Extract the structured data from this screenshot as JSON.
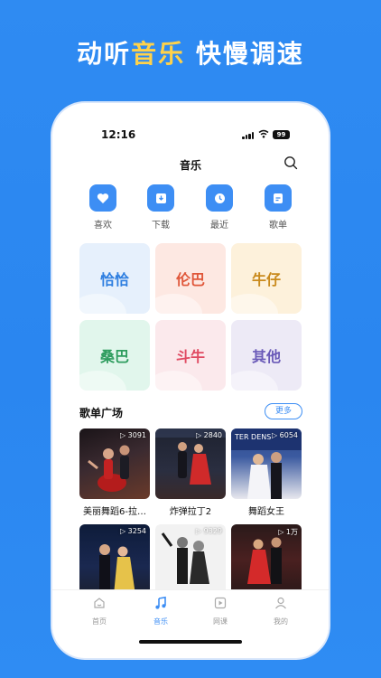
{
  "promo": {
    "headline_part1": "动听",
    "headline_highlight": "音乐",
    "headline_part2": " 快慢调速"
  },
  "status_bar": {
    "time": "12:16",
    "battery": "99"
  },
  "navbar": {
    "title": "音乐",
    "search_icon": "search-icon"
  },
  "quick_actions": [
    {
      "label": "喜欢",
      "icon": "heart-icon"
    },
    {
      "label": "下载",
      "icon": "download-icon"
    },
    {
      "label": "最近",
      "icon": "clock-icon"
    },
    {
      "label": "歌单",
      "icon": "playlist-icon"
    }
  ],
  "categories": [
    {
      "label": "恰恰",
      "bg": "#e6f0fc",
      "color": "#2f7fe0"
    },
    {
      "label": "伦巴",
      "bg": "#fde8e2",
      "color": "#e0573a"
    },
    {
      "label": "牛仔",
      "bg": "#fdf1db",
      "color": "#c98a1c"
    },
    {
      "label": "桑巴",
      "bg": "#e1f6ec",
      "color": "#2f9d5f"
    },
    {
      "label": "斗牛",
      "bg": "#fbe9ec",
      "color": "#e04a62"
    },
    {
      "label": "其他",
      "bg": "#edeaf6",
      "color": "#6a5ab8"
    }
  ],
  "playlist_section": {
    "title": "歌单广场",
    "more_label": "更多"
  },
  "playlists": [
    {
      "title": "美丽舞蹈6-拉…",
      "count": "3091"
    },
    {
      "title": "炸弹拉丁2",
      "count": "2840"
    },
    {
      "title": "舞蹈女王",
      "count": "6054"
    },
    {
      "title": "",
      "count": "3254"
    },
    {
      "title": "",
      "count": "9329"
    },
    {
      "title": "",
      "count": "1万"
    }
  ],
  "tabbar": [
    {
      "label": "首页",
      "icon": "home-icon",
      "active": false
    },
    {
      "label": "音乐",
      "icon": "music-note-icon",
      "active": true
    },
    {
      "label": "网课",
      "icon": "video-course-icon",
      "active": false
    },
    {
      "label": "我的",
      "icon": "profile-icon",
      "active": false
    }
  ],
  "colors": {
    "background": "#2f8bf2",
    "accent": "#3d8ef4",
    "headline_highlight": "#ffd24a"
  }
}
